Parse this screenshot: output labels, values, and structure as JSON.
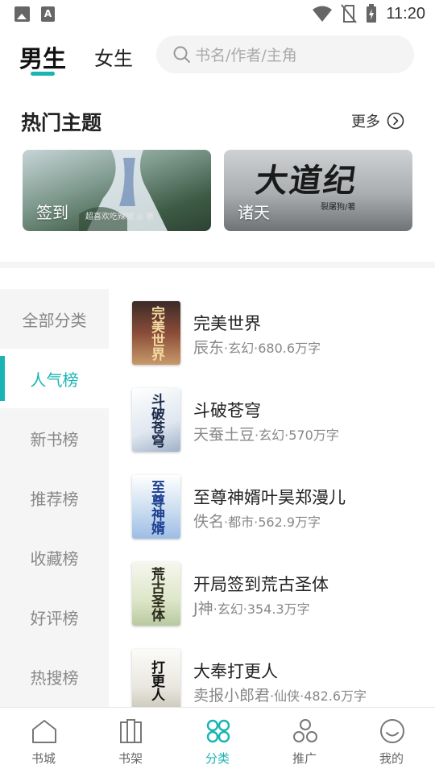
{
  "status_bar": {
    "time": "11:20",
    "left_icons": [
      "image-icon",
      "a-app-icon"
    ],
    "right_icons": [
      "wifi-icon",
      "no-sim-icon",
      "battery-charging-icon"
    ],
    "a_glyph": "A"
  },
  "header": {
    "tabs": [
      {
        "label": "男生",
        "active": true
      },
      {
        "label": "女生",
        "active": false
      }
    ],
    "search": {
      "placeholder": "书名/作者/主角",
      "icon": "search-icon"
    }
  },
  "hot_topics": {
    "title": "热门主题",
    "more_label": "更多",
    "cards": [
      {
        "label": "签到",
        "caption": "超喜欢吃辣椒 ◎ 著"
      },
      {
        "label": "诸天",
        "cover_title": "大道纪",
        "caption": "裂屠狗/著"
      }
    ]
  },
  "categories": {
    "items": [
      {
        "label": "全部分类",
        "active": false
      },
      {
        "label": "人气榜",
        "active": true
      },
      {
        "label": "新书榜",
        "active": false
      },
      {
        "label": "推荐榜",
        "active": false
      },
      {
        "label": "收藏榜",
        "active": false
      },
      {
        "label": "好评榜",
        "active": false
      },
      {
        "label": "热搜榜",
        "active": false
      }
    ]
  },
  "books": [
    {
      "title": "完美世界",
      "author": "辰东",
      "genre": "玄幻",
      "words": "680.6万字",
      "cover_text": "完美世界",
      "cover_bg": "#7b3b2e",
      "cover_fg": "#f2d9a0"
    },
    {
      "title": "斗破苍穹",
      "author": "天蚕土豆",
      "genre": "玄幻",
      "words": "570万字",
      "cover_text": "斗破苍穹",
      "cover_bg": "#e9eef3",
      "cover_fg": "#1c2a4a"
    },
    {
      "title": "至尊神婿叶昊郑漫儿",
      "author": "佚名",
      "genre": "都市",
      "words": "562.9万字",
      "cover_text": "至尊神婿",
      "cover_bg": "#d7e6f5",
      "cover_fg": "#1d3f8f"
    },
    {
      "title": "开局签到荒古圣体",
      "author": "J神",
      "genre": "玄幻",
      "words": "354.3万字",
      "cover_text": "荒古圣体",
      "cover_bg": "#eef1e4",
      "cover_fg": "#2a2a1a"
    },
    {
      "title": "大奉打更人",
      "author": "卖报小郎君",
      "genre": "仙侠",
      "words": "482.6万字",
      "cover_text": "打更人",
      "cover_bg": "#f1f0ec",
      "cover_fg": "#111111"
    }
  ],
  "bottom_nav": [
    {
      "label": "书城",
      "icon": "home-icon",
      "active": false
    },
    {
      "label": "书架",
      "icon": "bookshelf-icon",
      "active": false
    },
    {
      "label": "分类",
      "icon": "category-icon",
      "active": true
    },
    {
      "label": "推广",
      "icon": "share-icon",
      "active": false
    },
    {
      "label": "我的",
      "icon": "profile-icon",
      "active": false
    }
  ],
  "colors": {
    "accent": "#18b5b3",
    "muted_text": "#888888",
    "nav_bg": "#f5f5f6"
  }
}
